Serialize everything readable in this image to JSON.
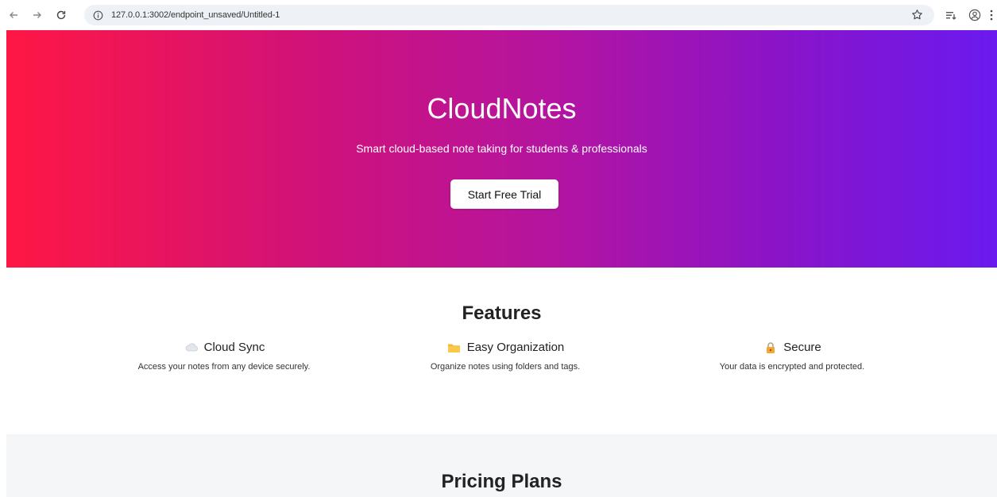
{
  "browser": {
    "url": "127.0.0.1:3002/endpoint_unsaved/Untitled-1",
    "icons": [
      "back-arrow-icon",
      "forward-arrow-icon",
      "reload-icon",
      "site-info-icon",
      "bookmark-star-icon",
      "tab-search-icon",
      "profile-icon",
      "menu-kebab-icon"
    ]
  },
  "hero": {
    "title": "CloudNotes",
    "subtitle": "Smart cloud-based note taking for students & professionals",
    "cta_label": "Start Free Trial",
    "gradient_start": "#ff1744",
    "gradient_end": "#6a1aef"
  },
  "features": {
    "heading": "Features",
    "items": [
      {
        "icon": "cloud-icon",
        "title": "Cloud Sync",
        "description": "Access your notes from any device securely."
      },
      {
        "icon": "folder-icon",
        "title": "Easy Organization",
        "description": "Organize notes using folders and tags."
      },
      {
        "icon": "lock-icon",
        "title": "Secure",
        "description": "Your data is encrypted and protected."
      }
    ]
  },
  "pricing": {
    "heading": "Pricing Plans"
  }
}
